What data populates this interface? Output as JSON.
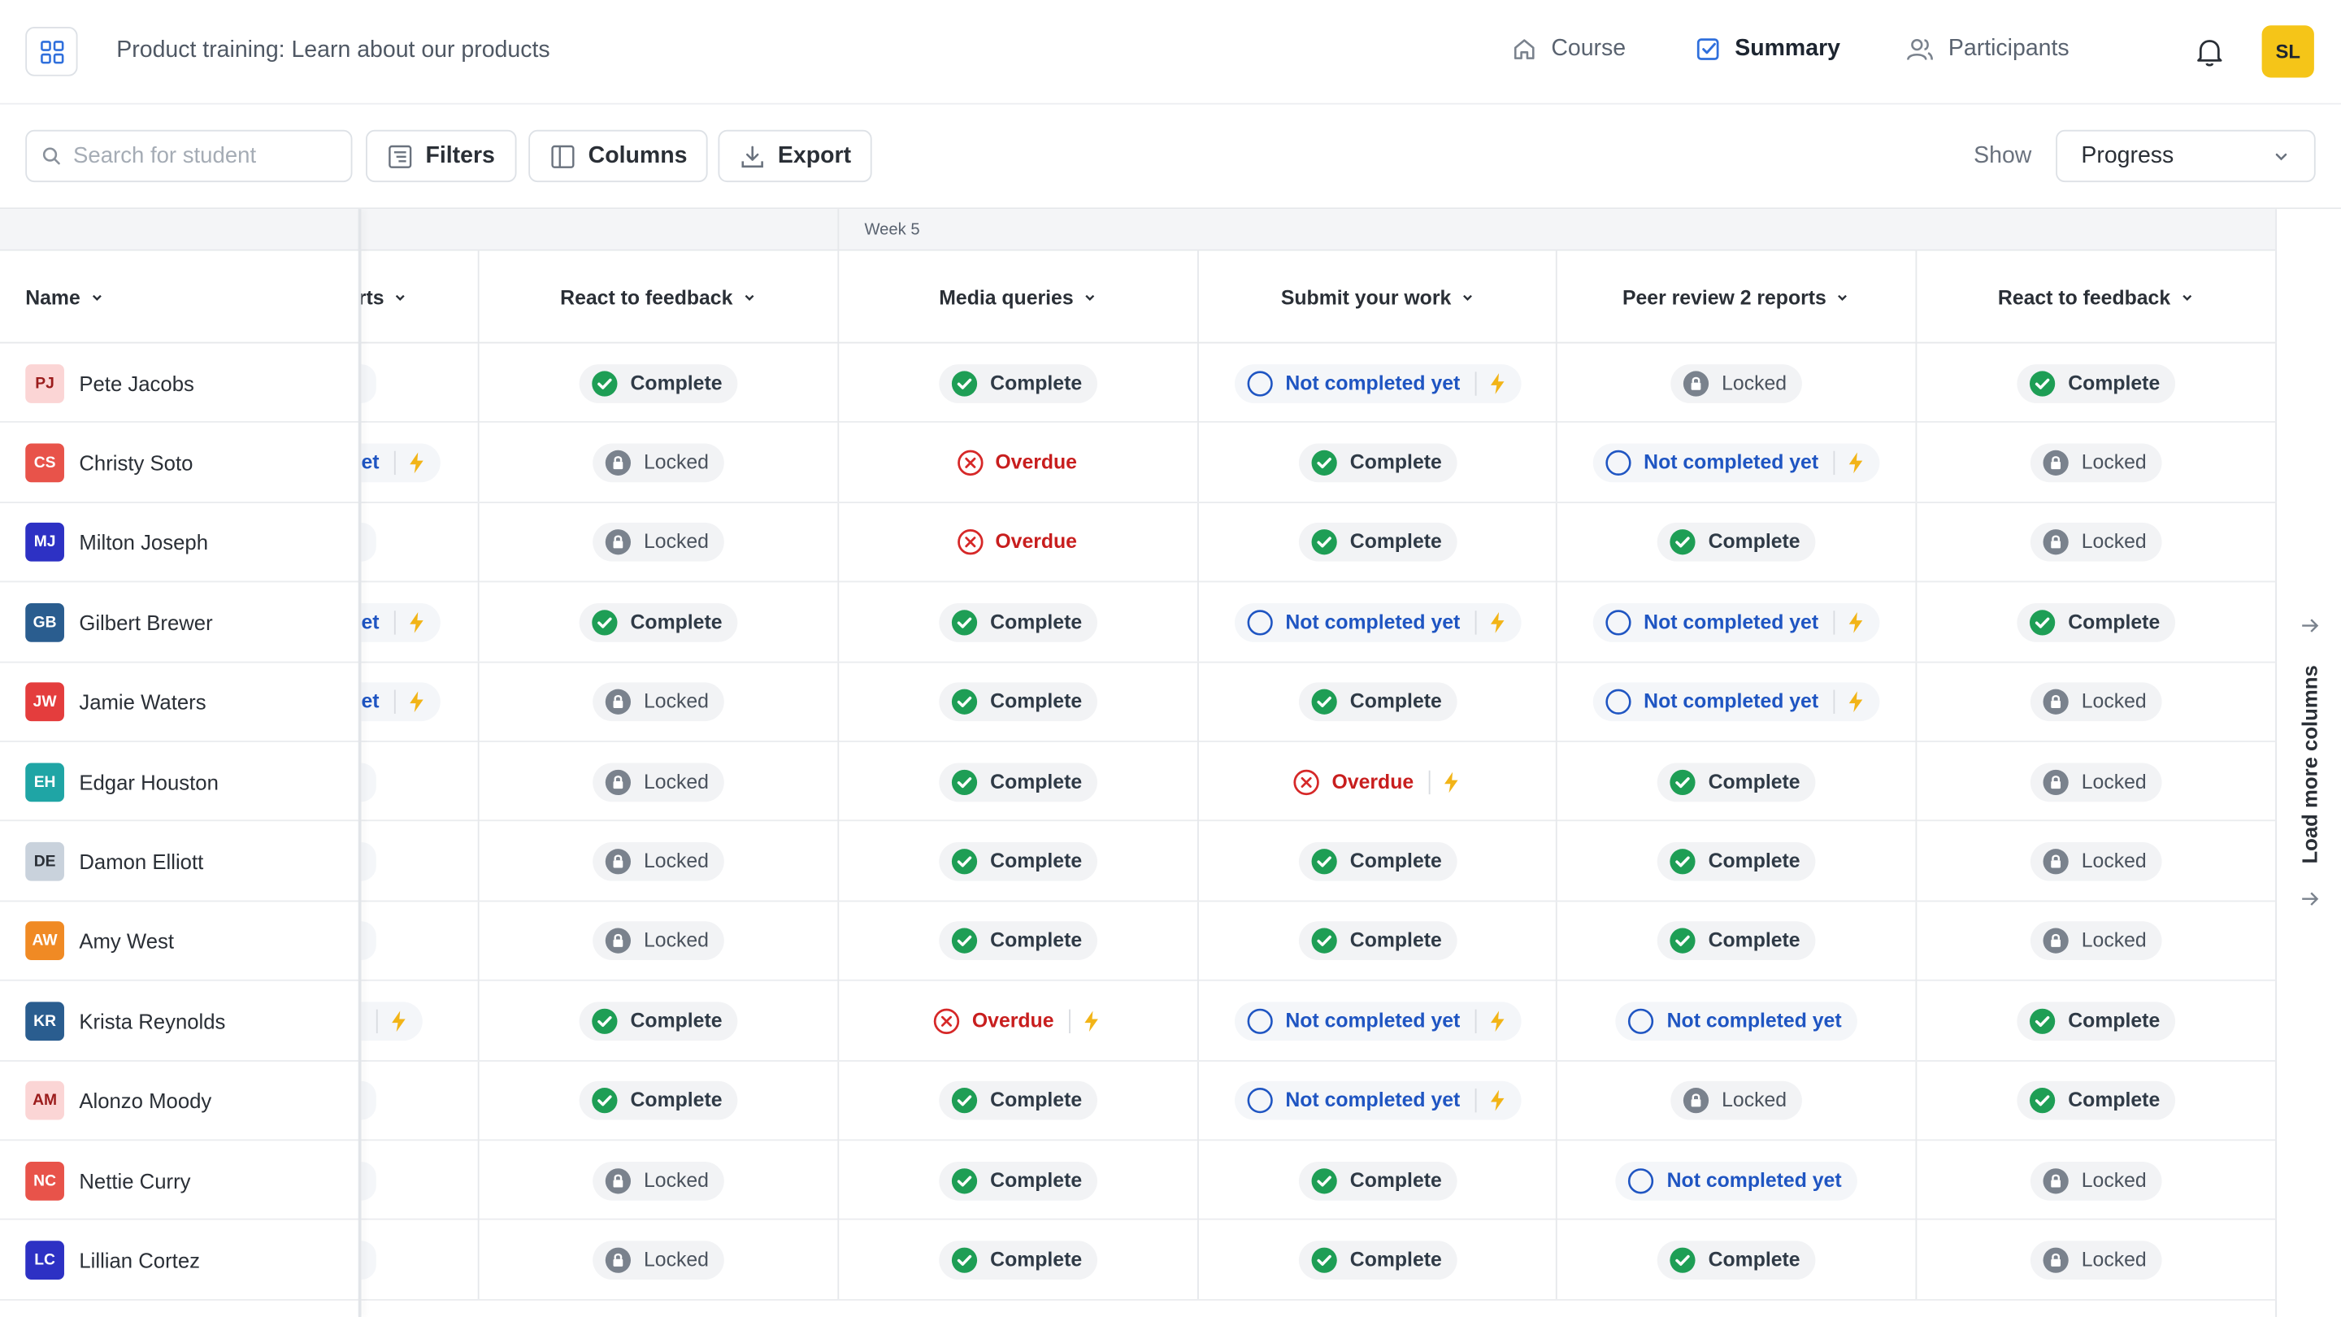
{
  "header": {
    "title": "Product training: Learn about our products",
    "nav": [
      {
        "label": "Course",
        "icon": "home-icon",
        "active": false
      },
      {
        "label": "Summary",
        "icon": "checkbox-icon",
        "active": true
      },
      {
        "label": "Participants",
        "icon": "users-icon",
        "active": false
      }
    ],
    "user_initials": "SL",
    "user_color": "#f5c518"
  },
  "toolbar": {
    "search_placeholder": "Search for student",
    "filters_label": "Filters",
    "columns_label": "Columns",
    "export_label": "Export",
    "show_label": "Show",
    "show_value": "Progress"
  },
  "table": {
    "group_label": "Week 5",
    "name_header": "Name",
    "partial_header": "rts",
    "columns": [
      "React to feedback",
      "Media queries",
      "Submit your work",
      "Peer review 2 reports",
      "React to feedback"
    ],
    "rows": [
      {
        "initials": "PJ",
        "name": "Pete Jacobs",
        "bg": "#fbd5d5",
        "fg": "#9b1c1c",
        "partial": {
          "text": "",
          "bolt": false
        },
        "cells": [
          {
            "s": "complete"
          },
          {
            "s": "complete"
          },
          {
            "s": "notyet",
            "bolt": true
          },
          {
            "s": "locked"
          },
          {
            "s": "complete"
          }
        ]
      },
      {
        "initials": "CS",
        "name": "Christy Soto",
        "bg": "#e8534a",
        "fg": "#ffffff",
        "partial": {
          "text": "et",
          "bolt": true
        },
        "cells": [
          {
            "s": "locked"
          },
          {
            "s": "overdue"
          },
          {
            "s": "complete"
          },
          {
            "s": "notyet",
            "bolt": true
          },
          {
            "s": "locked"
          }
        ]
      },
      {
        "initials": "MJ",
        "name": "Milton Joseph",
        "bg": "#2d31c4",
        "fg": "#ffffff",
        "partial": {
          "text": "",
          "bolt": false
        },
        "cells": [
          {
            "s": "locked"
          },
          {
            "s": "overdue"
          },
          {
            "s": "complete"
          },
          {
            "s": "complete"
          },
          {
            "s": "locked"
          }
        ]
      },
      {
        "initials": "GB",
        "name": "Gilbert Brewer",
        "bg": "#2a5d8f",
        "fg": "#ffffff",
        "partial": {
          "text": "et",
          "bolt": true
        },
        "cells": [
          {
            "s": "complete"
          },
          {
            "s": "complete"
          },
          {
            "s": "notyet",
            "bolt": true
          },
          {
            "s": "notyet",
            "bolt": true
          },
          {
            "s": "complete"
          }
        ]
      },
      {
        "initials": "JW",
        "name": "Jamie Waters",
        "bg": "#e43d3d",
        "fg": "#ffffff",
        "partial": {
          "text": "et",
          "bolt": true
        },
        "cells": [
          {
            "s": "locked"
          },
          {
            "s": "complete"
          },
          {
            "s": "complete"
          },
          {
            "s": "notyet",
            "bolt": true
          },
          {
            "s": "locked"
          }
        ]
      },
      {
        "initials": "EH",
        "name": "Edgar Houston",
        "bg": "#1fa5a5",
        "fg": "#ffffff",
        "partial": {
          "text": "",
          "bolt": false
        },
        "cells": [
          {
            "s": "locked"
          },
          {
            "s": "complete"
          },
          {
            "s": "overdue",
            "bolt": true
          },
          {
            "s": "complete"
          },
          {
            "s": "locked"
          }
        ]
      },
      {
        "initials": "DE",
        "name": "Damon Elliott",
        "bg": "#c9d2dc",
        "fg": "#2a2f36",
        "partial": {
          "text": "",
          "bolt": false
        },
        "cells": [
          {
            "s": "locked"
          },
          {
            "s": "complete"
          },
          {
            "s": "complete"
          },
          {
            "s": "complete"
          },
          {
            "s": "locked"
          }
        ]
      },
      {
        "initials": "AW",
        "name": "Amy West",
        "bg": "#f08a24",
        "fg": "#ffffff",
        "partial": {
          "text": "",
          "bolt": false
        },
        "cells": [
          {
            "s": "locked"
          },
          {
            "s": "complete"
          },
          {
            "s": "complete"
          },
          {
            "s": "complete"
          },
          {
            "s": "locked"
          }
        ]
      },
      {
        "initials": "KR",
        "name": "Krista Reynolds",
        "bg": "#2a5d8f",
        "fg": "#ffffff",
        "partial": {
          "text": "",
          "bolt": true
        },
        "cells": [
          {
            "s": "complete"
          },
          {
            "s": "overdue",
            "bolt": true
          },
          {
            "s": "notyet",
            "bolt": true
          },
          {
            "s": "notyet"
          },
          {
            "s": "complete"
          }
        ]
      },
      {
        "initials": "AM",
        "name": "Alonzo Moody",
        "bg": "#fbd5d5",
        "fg": "#9b1c1c",
        "partial": {
          "text": "",
          "bolt": false
        },
        "cells": [
          {
            "s": "complete"
          },
          {
            "s": "complete"
          },
          {
            "s": "notyet",
            "bolt": true
          },
          {
            "s": "locked"
          },
          {
            "s": "complete"
          }
        ]
      },
      {
        "initials": "NC",
        "name": "Nettie Curry",
        "bg": "#e8534a",
        "fg": "#ffffff",
        "partial": {
          "text": "",
          "bolt": false
        },
        "cells": [
          {
            "s": "locked"
          },
          {
            "s": "complete"
          },
          {
            "s": "complete"
          },
          {
            "s": "notyet"
          },
          {
            "s": "locked"
          }
        ]
      },
      {
        "initials": "LC",
        "name": "Lillian Cortez",
        "bg": "#2d31c4",
        "fg": "#ffffff",
        "partial": {
          "text": "",
          "bolt": false
        },
        "cells": [
          {
            "s": "locked"
          },
          {
            "s": "complete"
          },
          {
            "s": "complete"
          },
          {
            "s": "complete"
          },
          {
            "s": "locked"
          }
        ]
      }
    ]
  },
  "status_labels": {
    "complete": "Complete",
    "locked": "Locked",
    "overdue": "Overdue",
    "notyet": "Not completed yet"
  },
  "colors": {
    "complete": "#1e9e55",
    "locked": "#7a828d",
    "overdue": "#d62828",
    "notyet": "#1f55c2",
    "bolt": "#f2b417"
  },
  "load_more_label": "Load more columns"
}
